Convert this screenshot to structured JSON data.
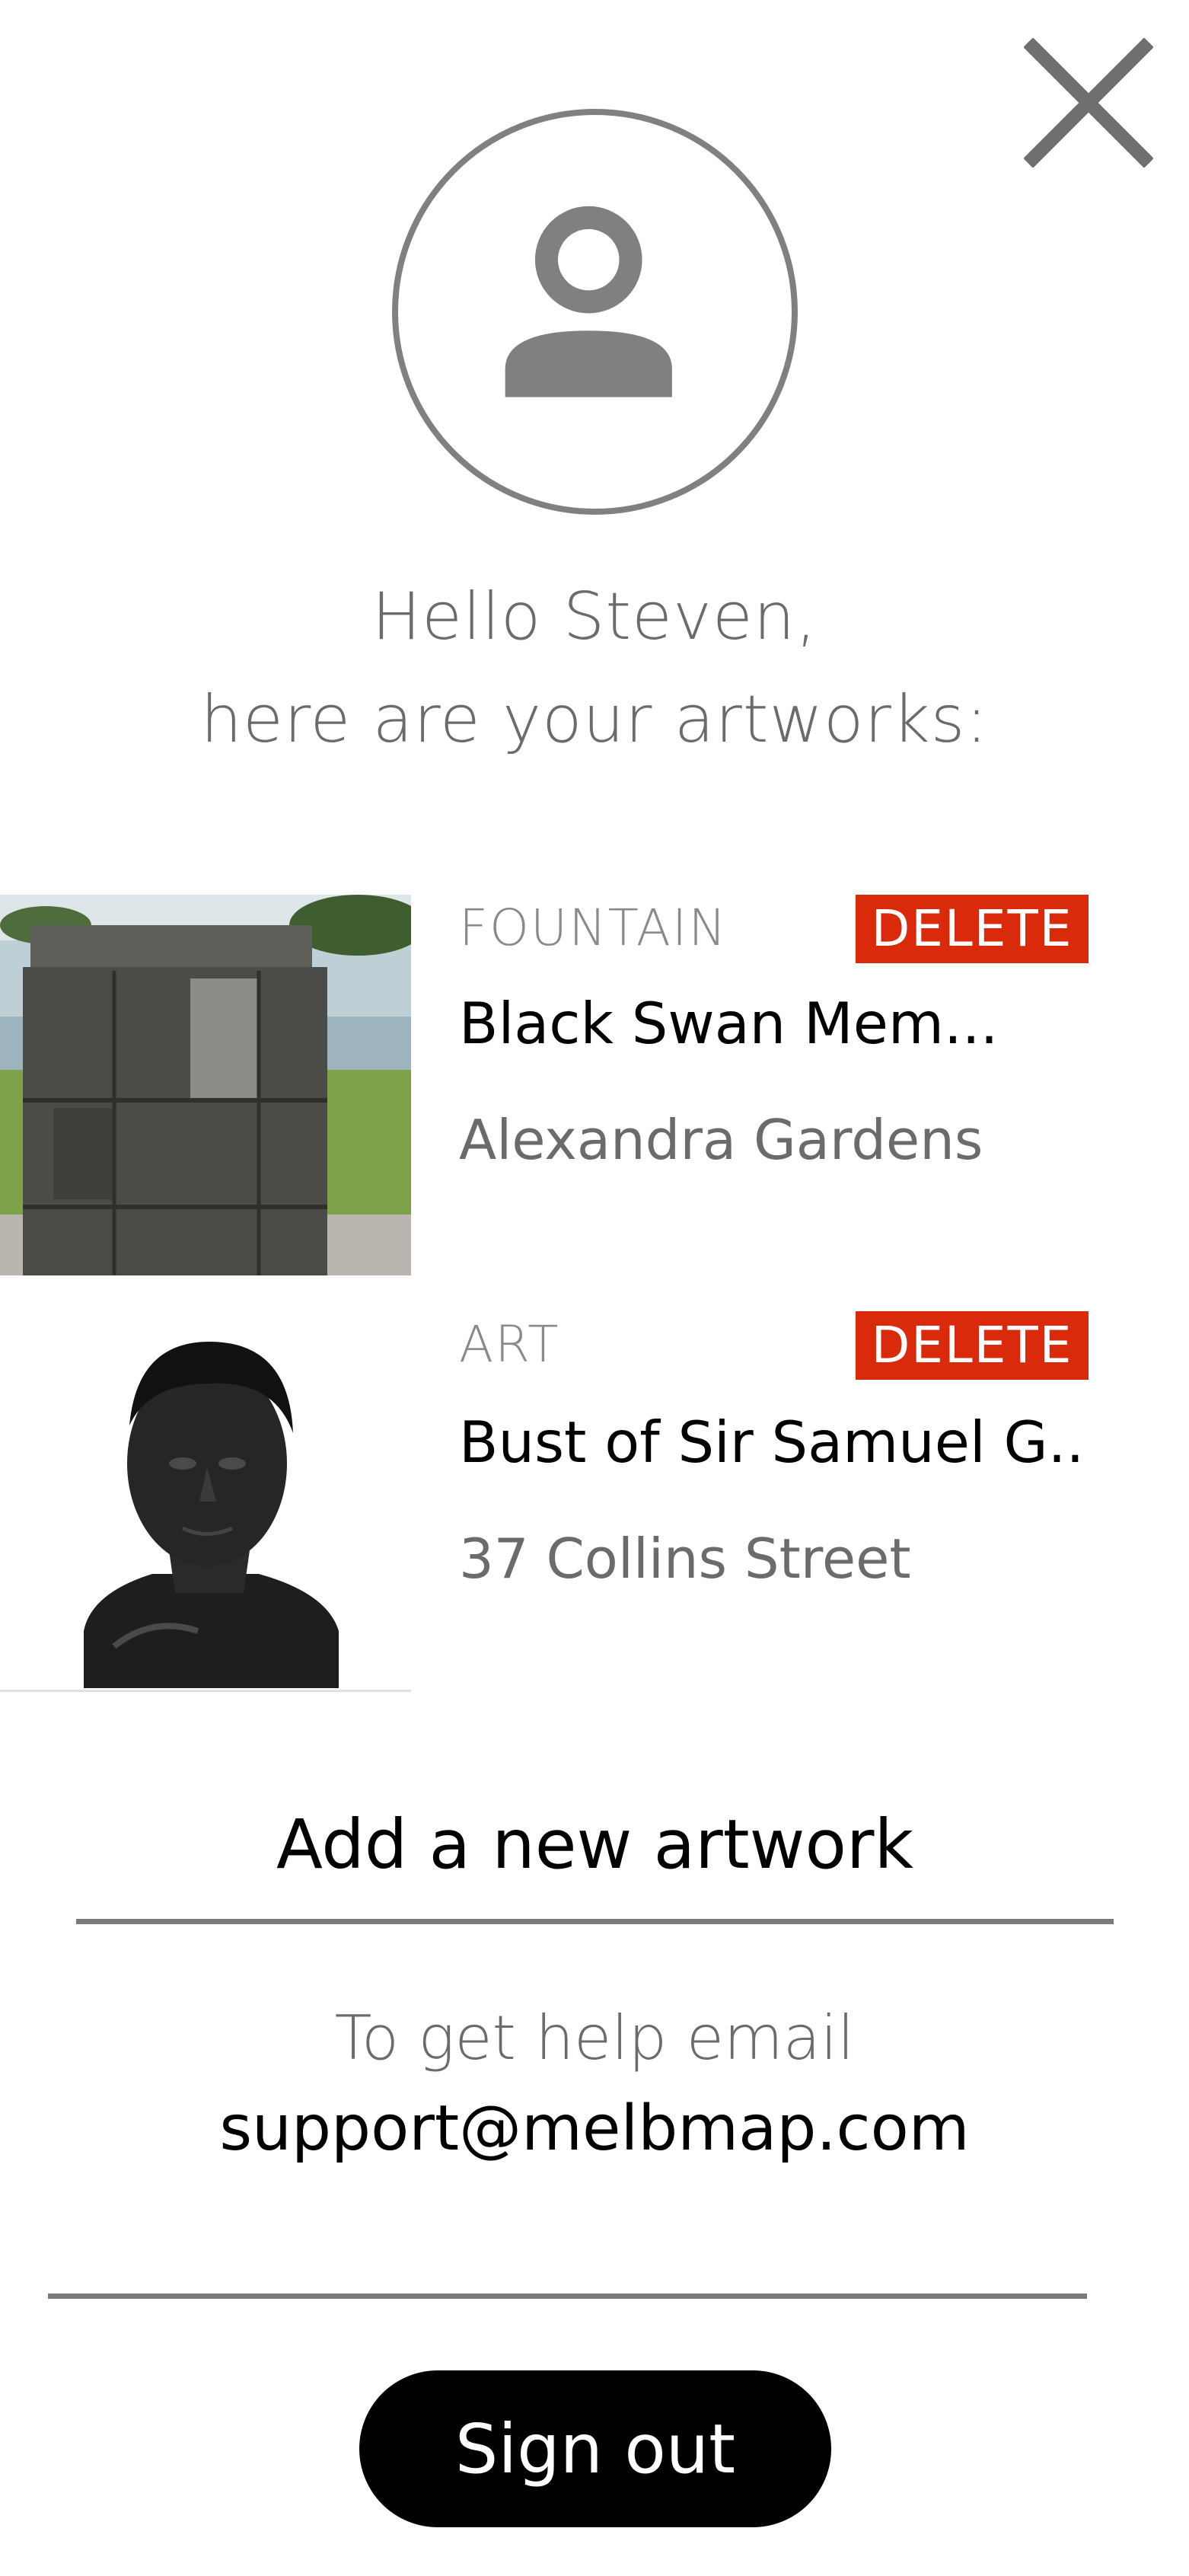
{
  "header": {
    "close_icon": "close-icon",
    "avatar_icon": "person-icon"
  },
  "greeting": {
    "line1": "Hello Steven,",
    "line2": "here are your artworks:"
  },
  "artworks": [
    {
      "category": "FOUNTAIN",
      "title": "Black Swan Mem...",
      "location": "Alexandra Gardens",
      "delete_label": "DELETE"
    },
    {
      "category": "ART",
      "title": "Bust of Sir Samuel G..",
      "location": "37 Collins Street",
      "delete_label": "DELETE"
    }
  ],
  "add_artwork_label": "Add a new artwork",
  "help": {
    "text": "To get help email",
    "email": "support@melbmap.com"
  },
  "sign_out_label": "Sign out",
  "colors": {
    "delete": "#d92b0b",
    "accent": "#000000",
    "muted": "#808080"
  }
}
